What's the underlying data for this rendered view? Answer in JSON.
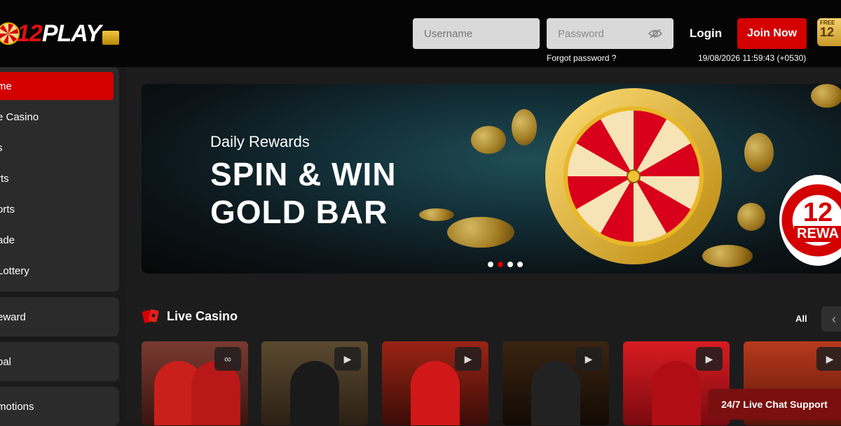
{
  "brand": {
    "logo_text_num": "12",
    "logo_text_play": "PLAY"
  },
  "header": {
    "username_placeholder": "Username",
    "password_placeholder": "Password",
    "forgot_password": "Forgot password ?",
    "login_label": "Login",
    "join_label": "Join Now",
    "datetime": "19/08/2026 11:59:43 (+0530)",
    "free_badge_top": "FREE",
    "free_badge_num": "12"
  },
  "sidebar": {
    "items": [
      {
        "label": "me",
        "active": true,
        "icon": "home-icon"
      },
      {
        "label": "e Casino",
        "active": false,
        "icon": "casino-icon"
      },
      {
        "label": "s",
        "active": false,
        "icon": "slots-icon"
      },
      {
        "label": "rts",
        "active": false,
        "icon": "sports-icon"
      },
      {
        "label": "orts",
        "active": false,
        "icon": "esports-icon"
      },
      {
        "label": "ade",
        "active": false,
        "icon": "arcade-icon"
      },
      {
        "label": "Lottery",
        "active": false,
        "icon": "lottery-icon"
      }
    ],
    "extra": [
      {
        "label": "eward"
      },
      {
        "label": "oal"
      },
      {
        "label": "motions"
      }
    ]
  },
  "banner": {
    "subtitle": "Daily Rewards",
    "title_line1": "SPIN & WIN",
    "title_line2": "GOLD BAR",
    "badge_num": "12",
    "badge_text": "REWA",
    "dots_count": 4,
    "active_dot": 1
  },
  "live_casino": {
    "title": "Live Casino",
    "all_label": "All",
    "prev_icon": "chevron-left-icon",
    "games": [
      {
        "provider_icon": "infinity-icon",
        "bg": "#6b2a25"
      },
      {
        "provider_icon": "play-icon",
        "bg": "#3a2c1c"
      },
      {
        "provider_icon": "play-icon",
        "bg": "#7a1e12"
      },
      {
        "provider_icon": "play-icon",
        "bg": "#2a1a10"
      },
      {
        "provider_icon": "play-icon",
        "bg": "#b0121a"
      },
      {
        "provider_icon": "play-icon",
        "bg": "#9a2414"
      }
    ]
  },
  "chat": {
    "label": "24/7 Live Chat Support"
  },
  "colors": {
    "accent": "#d40000",
    "gold": "#e8b828",
    "bg": "#1a1a1a"
  }
}
